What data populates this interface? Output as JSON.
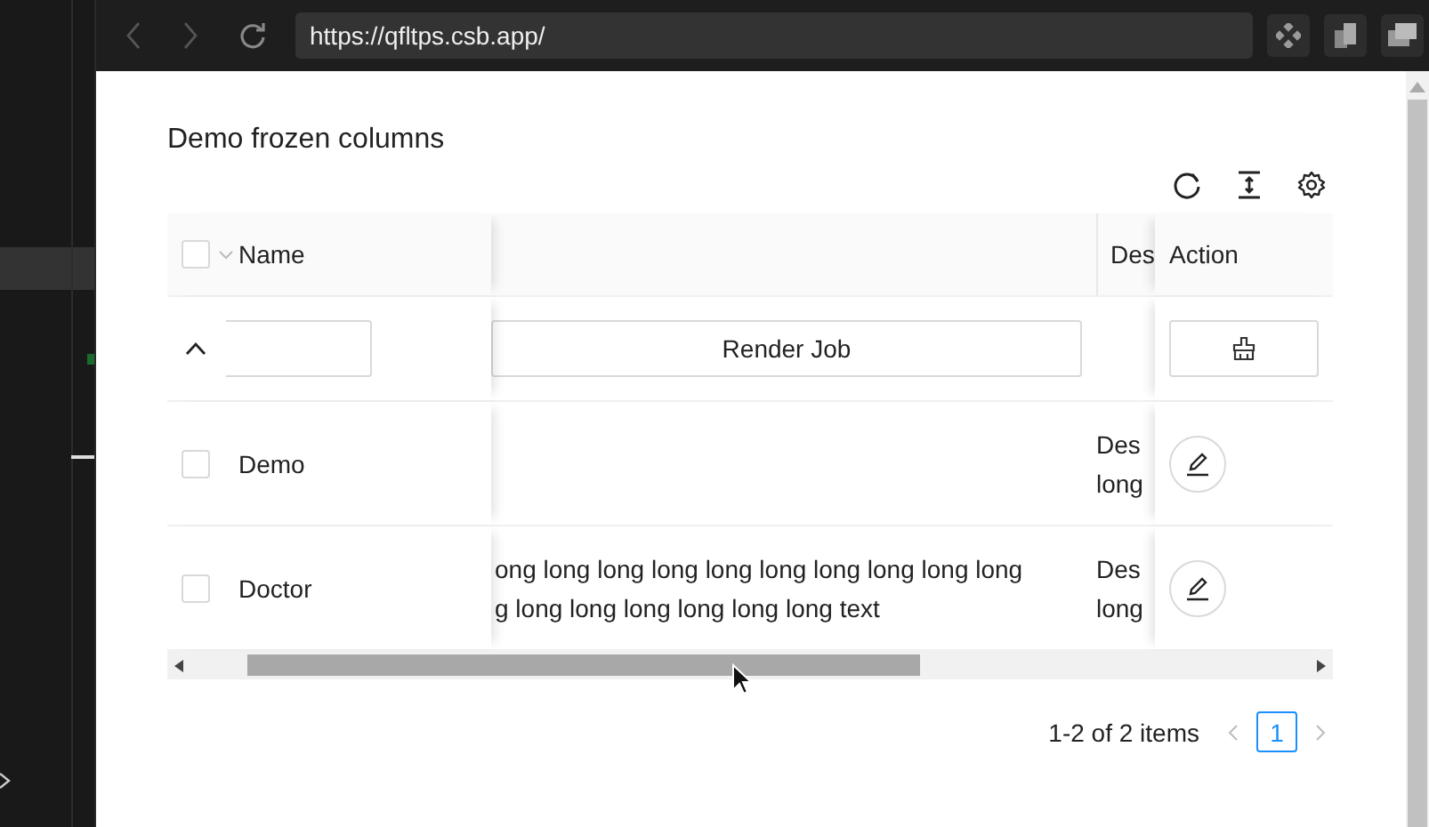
{
  "browser": {
    "url": "https://qfltps.csb.app/"
  },
  "page": {
    "title": "Demo frozen columns"
  },
  "table": {
    "header_checked": false,
    "columns": [
      {
        "label": "Name"
      },
      {
        "label": "Des"
      },
      {
        "label": "Action"
      }
    ],
    "filter": {
      "expanded": true,
      "button": "Render Job"
    },
    "rows": [
      {
        "checked": false,
        "name": "Demo",
        "description": "Des long"
      },
      {
        "checked": false,
        "name": "Doctor",
        "text_lines": [
          "ong long long long long long long long long long",
          "g long long long long long long text"
        ],
        "description": "Des long"
      }
    ]
  },
  "pagination": {
    "summary": "1-2 of 2 items",
    "pages": [
      {
        "label": "1",
        "selected": true
      }
    ]
  }
}
